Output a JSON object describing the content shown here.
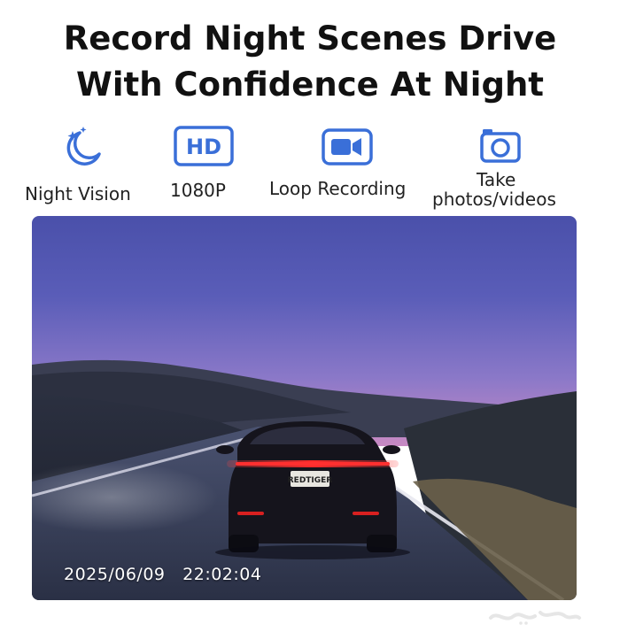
{
  "headline": {
    "line1": "Record Night Scenes Drive",
    "line2": "With Confidence At Night"
  },
  "features": [
    {
      "icon": "moon-stars-icon",
      "label": "Night Vision"
    },
    {
      "icon": "hd-icon",
      "label": "1080P",
      "icon_text": "HD"
    },
    {
      "icon": "video-camera-icon",
      "label": "Loop Recording"
    },
    {
      "icon": "photo-camera-icon",
      "label_line1": "Take",
      "label_line2": "photos/videos"
    }
  ],
  "photo": {
    "timestamp_date": "2025/06/09",
    "timestamp_time": "22:02:04",
    "license_plate": "REDTIGER"
  },
  "colors": {
    "accent": "#3a6fd8",
    "text": "#111111",
    "sky_top": "#4a4fa8",
    "sky_horizon": "#c88ac4",
    "tail_light": "#ff2a2a"
  }
}
